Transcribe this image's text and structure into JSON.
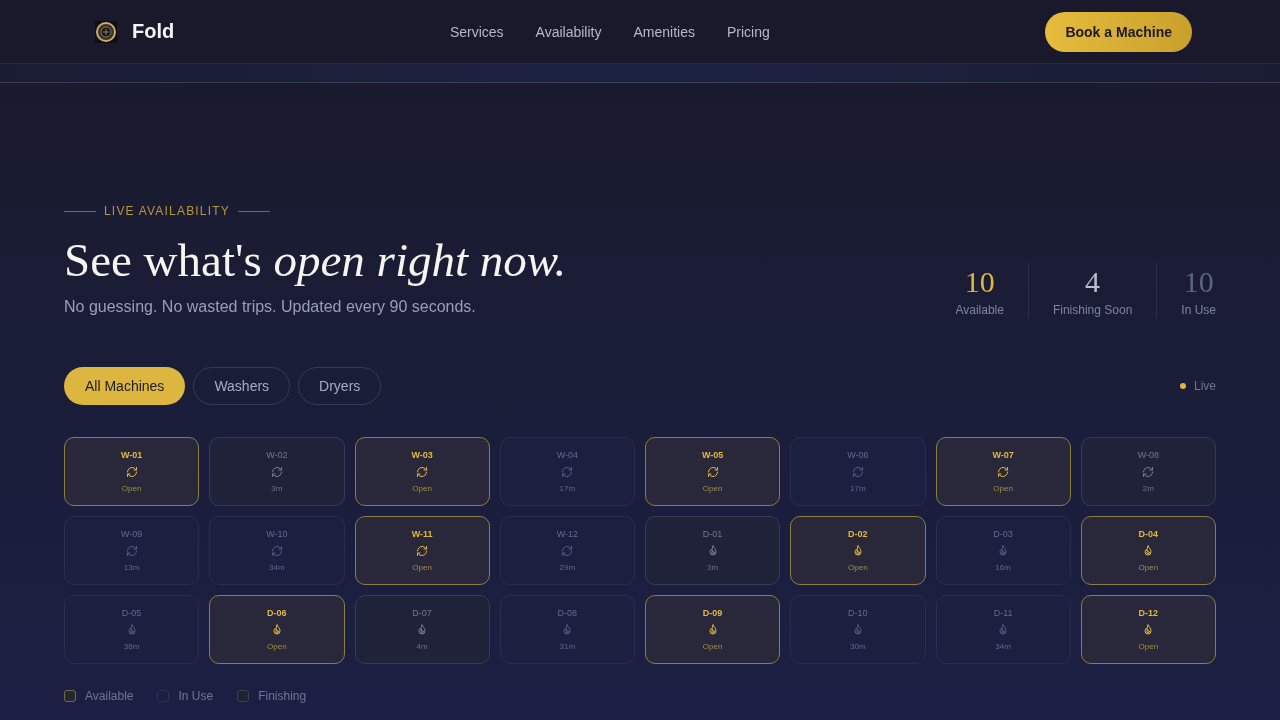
{
  "header": {
    "brand": "Fold",
    "nav": [
      "Services",
      "Availability",
      "Amenities",
      "Pricing"
    ],
    "cta": "Book a Machine"
  },
  "hero": {
    "eyebrow": "LIVE AVAILABILITY",
    "heading": "See what's *open right now.*",
    "subtitle": "No guessing. No wasted trips. Updated every 90 seconds."
  },
  "stats": [
    {
      "kind": "available",
      "value": "10",
      "label": "Available"
    },
    {
      "kind": "finishing",
      "value": "4",
      "label": "Finishing Soon"
    },
    {
      "kind": "in_use",
      "value": "10",
      "label": "In Use"
    }
  ],
  "filters": [
    {
      "label": "All Machines",
      "selected": true
    },
    {
      "label": "Washers",
      "selected": false
    },
    {
      "label": "Dryers",
      "selected": false
    }
  ],
  "live": {
    "label": "Live"
  },
  "machines": [
    {
      "id": "W-01",
      "kind": "washer",
      "available": true,
      "finishing": false,
      "label": "Open"
    },
    {
      "id": "W-02",
      "kind": "washer",
      "available": false,
      "finishing": true,
      "label": "3m"
    },
    {
      "id": "W-03",
      "kind": "washer",
      "available": true,
      "finishing": false,
      "label": "Open"
    },
    {
      "id": "W-04",
      "kind": "washer",
      "available": false,
      "finishing": false,
      "label": "17m"
    },
    {
      "id": "W-05",
      "kind": "washer",
      "available": true,
      "finishing": false,
      "label": "Open"
    },
    {
      "id": "W-06",
      "kind": "washer",
      "available": false,
      "finishing": false,
      "label": "17m"
    },
    {
      "id": "W-07",
      "kind": "washer",
      "available": true,
      "finishing": false,
      "label": "Open"
    },
    {
      "id": "W-08",
      "kind": "washer",
      "available": false,
      "finishing": true,
      "label": "2m"
    },
    {
      "id": "W-09",
      "kind": "washer",
      "available": false,
      "finishing": false,
      "label": "13m"
    },
    {
      "id": "W-10",
      "kind": "washer",
      "available": false,
      "finishing": false,
      "label": "34m"
    },
    {
      "id": "W-11",
      "kind": "washer",
      "available": true,
      "finishing": false,
      "label": "Open"
    },
    {
      "id": "W-12",
      "kind": "washer",
      "available": false,
      "finishing": false,
      "label": "29m"
    },
    {
      "id": "D-01",
      "kind": "dryer",
      "available": false,
      "finishing": true,
      "label": "3m"
    },
    {
      "id": "D-02",
      "kind": "dryer",
      "available": true,
      "finishing": false,
      "label": "Open"
    },
    {
      "id": "D-03",
      "kind": "dryer",
      "available": false,
      "finishing": false,
      "label": "16m"
    },
    {
      "id": "D-04",
      "kind": "dryer",
      "available": true,
      "finishing": false,
      "label": "Open"
    },
    {
      "id": "D-05",
      "kind": "dryer",
      "available": false,
      "finishing": false,
      "label": "36m"
    },
    {
      "id": "D-06",
      "kind": "dryer",
      "available": true,
      "finishing": false,
      "label": "Open"
    },
    {
      "id": "D-07",
      "kind": "dryer",
      "available": false,
      "finishing": true,
      "label": "4m"
    },
    {
      "id": "D-08",
      "kind": "dryer",
      "available": false,
      "finishing": false,
      "label": "31m"
    },
    {
      "id": "D-09",
      "kind": "dryer",
      "available": true,
      "finishing": false,
      "label": "Open"
    },
    {
      "id": "D-10",
      "kind": "dryer",
      "available": false,
      "finishing": false,
      "label": "30m"
    },
    {
      "id": "D-11",
      "kind": "dryer",
      "available": false,
      "finishing": false,
      "label": "34m"
    },
    {
      "id": "D-12",
      "kind": "dryer",
      "available": true,
      "finishing": false,
      "label": "Open"
    }
  ],
  "legend": [
    {
      "kind": "available",
      "label": "Available"
    },
    {
      "kind": "in_use",
      "label": "In Use"
    },
    {
      "kind": "finishing",
      "label": "Finishing"
    }
  ]
}
